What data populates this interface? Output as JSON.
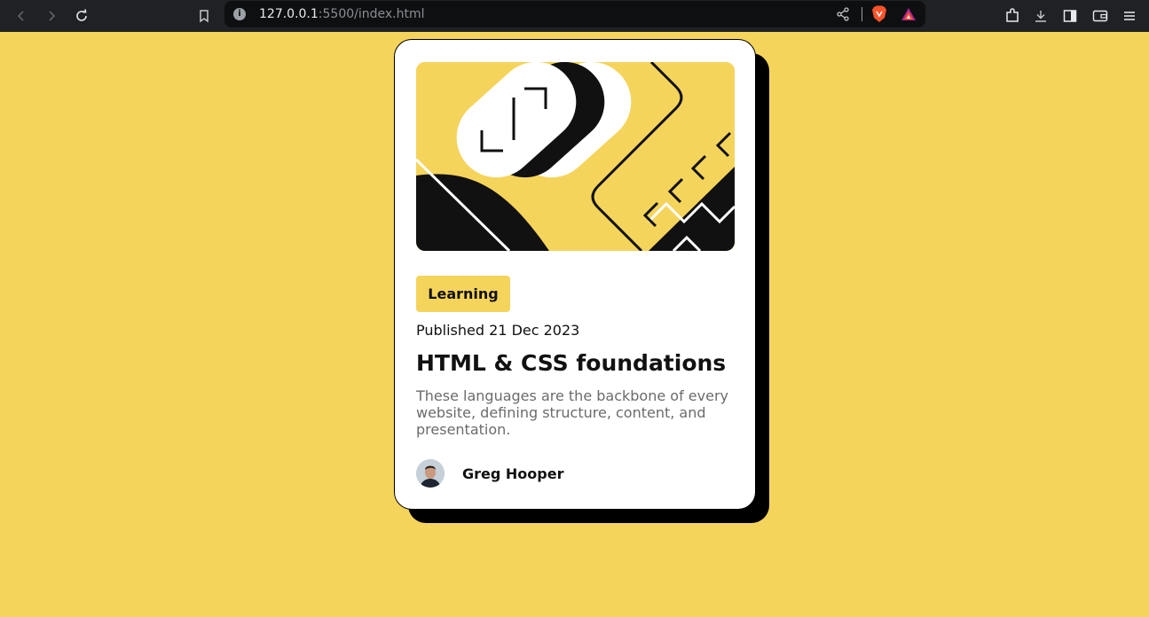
{
  "browser": {
    "url_host": "127.0.0.1",
    "url_rest": ":5500/index.html",
    "info_glyph": "i",
    "icons": [
      "back-icon",
      "forward-icon",
      "reload-icon",
      "bookmark-icon",
      "share-icon",
      "brave-shields-icon",
      "brave-rewards-icon",
      "extensions-icon",
      "downloads-icon",
      "sidebar-icon",
      "wallet-icon",
      "menu-icon"
    ]
  },
  "card": {
    "tag": "Learning",
    "published": "Published 21 Dec 2023",
    "title": "HTML & CSS foundations",
    "description": "These languages are the backbone of every website, defining structure, content, and presentation.",
    "author": "Greg Hooper"
  },
  "colors": {
    "page_bg": "#f5d45c",
    "card_bg": "#ffffff",
    "shadow": "#000000",
    "text_primary": "#111111",
    "text_secondary": "#6b6b6b"
  }
}
